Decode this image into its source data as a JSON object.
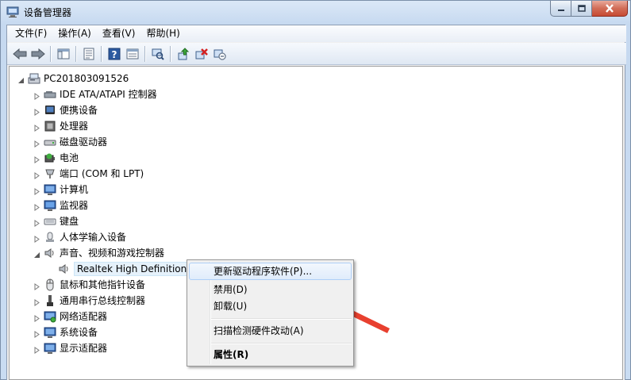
{
  "window": {
    "title": "设备管理器",
    "controls": [
      "minimize",
      "maximize",
      "close"
    ]
  },
  "menubar": {
    "items": [
      "文件(F)",
      "操作(A)",
      "查看(V)",
      "帮助(H)"
    ]
  },
  "toolbar": {
    "icons": [
      "back-icon",
      "forward-icon",
      "show-hide-tree-icon",
      "properties-icon",
      "help-icon",
      "view-icon",
      "scan-hardware-icon",
      "update-driver-icon",
      "uninstall-icon",
      "disable-icon"
    ]
  },
  "tree": {
    "root": "PC201803091526",
    "items": [
      {
        "label": "IDE ATA/ATAPI 控制器",
        "icon": "ide-controller-icon",
        "expanded": false
      },
      {
        "label": "便携设备",
        "icon": "portable-device-icon",
        "expanded": false
      },
      {
        "label": "处理器",
        "icon": "processor-icon",
        "expanded": false
      },
      {
        "label": "磁盘驱动器",
        "icon": "disk-drive-icon",
        "expanded": false
      },
      {
        "label": "电池",
        "icon": "battery-icon",
        "expanded": false
      },
      {
        "label": "端口 (COM 和 LPT)",
        "icon": "port-icon",
        "expanded": false
      },
      {
        "label": "计算机",
        "icon": "computer-icon",
        "expanded": false
      },
      {
        "label": "监视器",
        "icon": "monitor-icon",
        "expanded": false
      },
      {
        "label": "键盘",
        "icon": "keyboard-icon",
        "expanded": false
      },
      {
        "label": "人体学输入设备",
        "icon": "hid-icon",
        "expanded": false
      },
      {
        "label": "声音、视频和游戏控制器",
        "icon": "sound-icon",
        "expanded": true
      },
      {
        "label": "Realtek High Definition A",
        "icon": "speaker-icon",
        "child": true,
        "selected": true
      },
      {
        "label": "鼠标和其他指针设备",
        "icon": "mouse-icon",
        "expanded": false
      },
      {
        "label": "通用串行总线控制器",
        "icon": "usb-icon",
        "expanded": false
      },
      {
        "label": "网络适配器",
        "icon": "network-adapter-icon",
        "expanded": false
      },
      {
        "label": "系统设备",
        "icon": "system-device-icon",
        "expanded": false
      },
      {
        "label": "显示适配器",
        "icon": "display-adapter-icon",
        "expanded": false
      }
    ]
  },
  "context_menu": {
    "items": [
      {
        "label": "更新驱动程序软件(P)...",
        "hover": true
      },
      {
        "label": "禁用(D)"
      },
      {
        "label": "卸载(U)"
      },
      {
        "label": "扫描检测硬件改动(A)"
      },
      {
        "label": "属性(R)",
        "bold": true
      }
    ]
  },
  "colors": {
    "annotation_arrow": "#e8402f",
    "selection_bg": "#e5f1fb",
    "hover_border": "#aecff7"
  }
}
